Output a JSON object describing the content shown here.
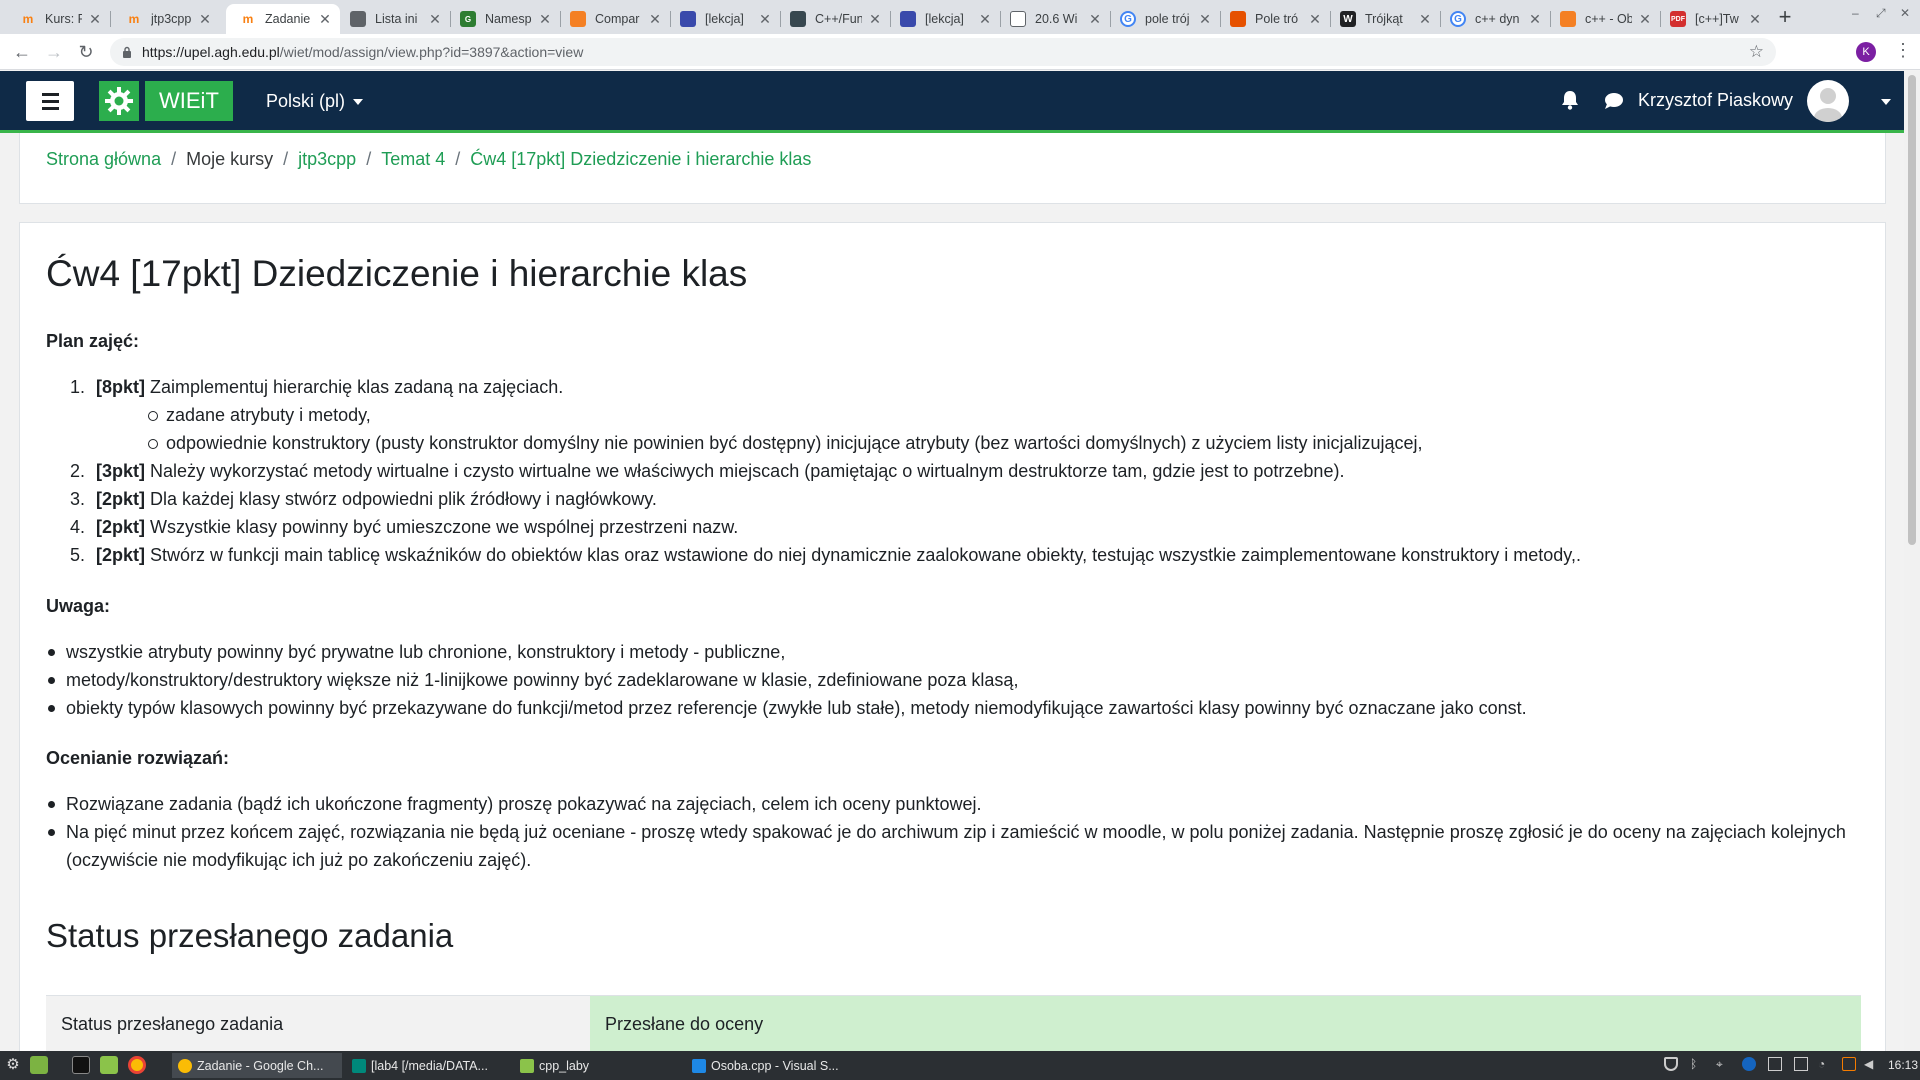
{
  "browser": {
    "tabs": [
      {
        "title": "Kurs: Pr",
        "icon": "moodle-icon",
        "color": "#f98012"
      },
      {
        "title": "jtp3cpp",
        "icon": "moodle-icon",
        "color": "#f98012"
      },
      {
        "title": "Zadanie",
        "icon": "moodle-icon",
        "color": "#f98012"
      },
      {
        "title": "Lista ini",
        "icon": "document-icon",
        "color": "#5f6368"
      },
      {
        "title": "Namesp",
        "icon": "site-icon",
        "color": "#2e7d32"
      },
      {
        "title": "Compar",
        "icon": "stackoverflow-icon",
        "color": "#f48024"
      },
      {
        "title": "[lekcja]",
        "icon": "site-icon",
        "color": "#3949ab"
      },
      {
        "title": "C++/Fun",
        "icon": "site-icon",
        "color": "#37474f"
      },
      {
        "title": "[lekcja]",
        "icon": "site-icon",
        "color": "#3949ab"
      },
      {
        "title": "20.6 Wi",
        "icon": "document-icon",
        "color": "#5f6368"
      },
      {
        "title": "pole trój",
        "icon": "google-icon",
        "color": "#4285f4"
      },
      {
        "title": "Pole tró",
        "icon": "site-icon",
        "color": "#e65100"
      },
      {
        "title": "Trójkąt",
        "icon": "wikipedia-icon",
        "color": "#202124"
      },
      {
        "title": "c++ dyn",
        "icon": "google-icon",
        "color": "#4285f4"
      },
      {
        "title": "c++ - Ob",
        "icon": "stackoverflow-icon",
        "color": "#f48024"
      },
      {
        "title": "[c++]Tw",
        "icon": "pdf-icon",
        "color": "#d32f2f"
      }
    ],
    "new_tab": "+",
    "url_host": "https://upel.agh.edu.pl",
    "url_path": "/wiet/mod/assign/view.php?id=3897&action=view",
    "profile_initial": "K"
  },
  "moodle": {
    "site_name": "WIEiT",
    "language": "Polski (pl)",
    "user_name": "Krzysztof Piaskowy",
    "accent": "#2cae4d",
    "navbar_color": "#0f2a47"
  },
  "breadcrumb": {
    "items": [
      "Strona główna",
      "Moje kursy",
      "jtp3cpp",
      "Temat 4",
      "Ćw4 [17pkt] Dziedziczenie i hierarchie klas"
    ],
    "separator": "/"
  },
  "assignment": {
    "title": "Ćw4 [17pkt] Dziedziczenie i hierarchie klas",
    "plan_heading": "Plan zajęć:",
    "plan": [
      {
        "num": "1.",
        "pts": "[8pkt]",
        "text": " Zaimplementuj hierarchię klas zadaną na zajęciach."
      },
      {
        "num": "2.",
        "pts": "[3pkt]",
        "text": " Należy wykorzystać metody wirtualne i czysto wirtualne we właściwych miejscach (pamiętając o wirtualnym destruktorze tam, gdzie jest to potrzebne)."
      },
      {
        "num": "3.",
        "pts": "[2pkt]",
        "text": " Dla każdej klasy stwórz odpowiedni plik źródłowy i nagłówkowy."
      },
      {
        "num": "4.",
        "pts": "[2pkt]",
        "text": " Wszystkie klasy powinny być umieszczone we wspólnej przestrzeni nazw."
      },
      {
        "num": "5.",
        "pts": "[2pkt]",
        "text": " Stwórz w funkcji main tablicę wskaźników do obiektów klas oraz wstawione do niej dynamicznie zaalokowane obiekty, testując wszystkie zaimplementowane konstruktory i metody,."
      }
    ],
    "plan_sub": [
      "zadane atrybuty i metody,",
      "odpowiednie konstruktory (pusty konstruktor domyślny nie powinien być dostępny) inicjujące atrybuty (bez wartości domyślnych) z użyciem listy inicjalizującej,"
    ],
    "note_heading": "Uwaga:",
    "notes": [
      "wszystkie atrybuty powinny być prywatne lub chronione, konstruktory i metody - publiczne,",
      "metody/konstruktory/destruktory większe niż 1-linijkowe powinny być zadeklarowane w klasie, zdefiniowane poza klasą,",
      "obiekty typów klasowych powinny być przekazywane do funkcji/metod przez referencje (zwykłe lub stałe), metody niemodyfikujące zawartości klasy powinny być oznaczane jako const."
    ],
    "grading_heading": "Ocenianie rozwiązań:",
    "grading": [
      "Rozwiązane zadania (bądź ich ukończone fragmenty) proszę pokazywać na zajęciach, celem ich oceny punktowej.",
      "Na pięć minut przez końcem zajęć, rozwiązania nie będą już oceniane - proszę wtedy spakować je do archiwum zip i zamieścić w moodle, w polu poniżej zadania. Następnie proszę zgłosić je do oceny na zajęciach kolejnych (oczywiście nie modyfikując ich już po zakończeniu zajęć)."
    ],
    "status_heading": "Status przesłanego zadania",
    "status_label": "Status przesłanego zadania",
    "status_value": "Przesłane do oceny",
    "status_color": "#cfefcf"
  },
  "taskbar": {
    "tasks": [
      {
        "title": "Zadanie - Google Ch...",
        "active": true
      },
      {
        "title": "[lab4 [/media/DATA...",
        "active": false
      },
      {
        "title": "cpp_laby",
        "active": false
      },
      {
        "title": "Osoba.cpp - Visual S...",
        "active": false
      }
    ],
    "clock": "16:13"
  }
}
